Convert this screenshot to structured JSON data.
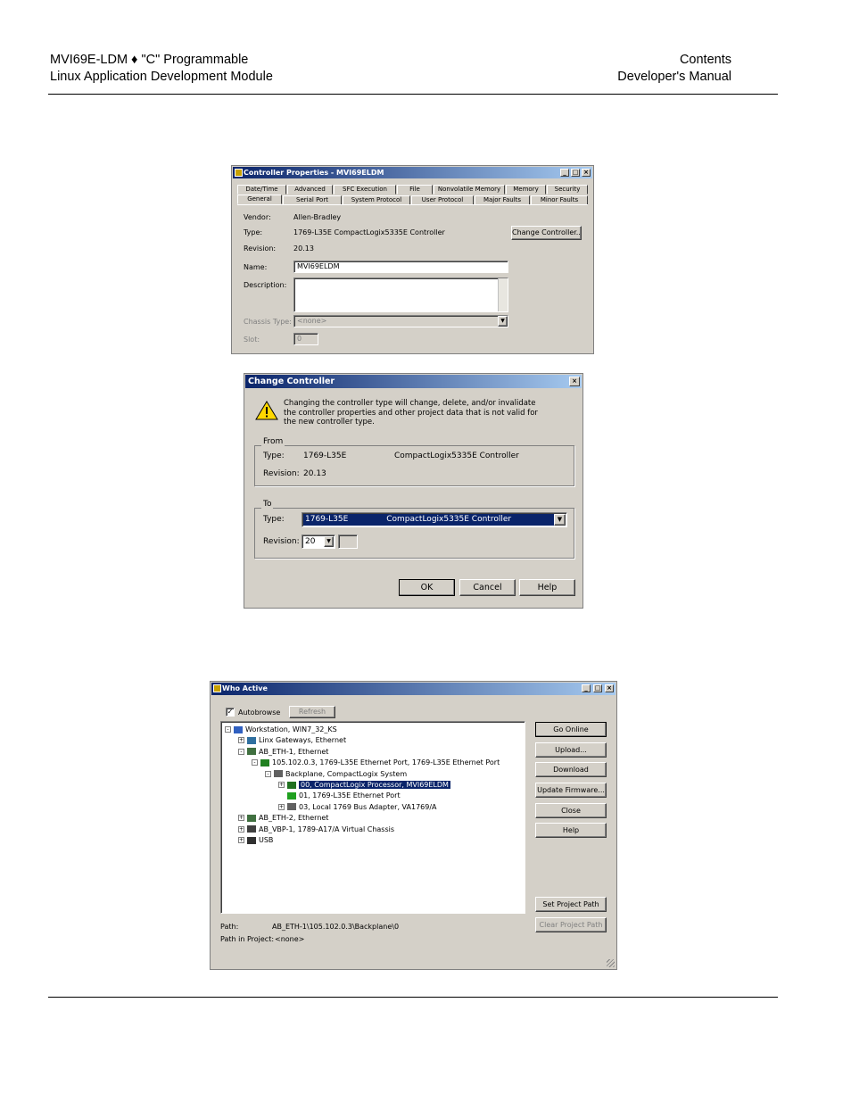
{
  "header": {
    "left_line1": "MVI69E-LDM ♦ \"C\" Programmable",
    "left_line2": "Linux Application Development Module",
    "right_line1": "Contents",
    "right_line2": "Developer's Manual"
  },
  "controller_properties": {
    "title": "Controller Properties - MVI69ELDM",
    "tabs_row1": [
      "Date/Time",
      "Advanced",
      "SFC Execution",
      "File",
      "Nonvolatile Memory",
      "Memory",
      "Security"
    ],
    "tabs_row2": [
      "General",
      "Serial Port",
      "System Protocol",
      "User Protocol",
      "Major Faults",
      "Minor Faults"
    ],
    "vendor_label": "Vendor:",
    "vendor_value": "Allen-Bradley",
    "type_label": "Type:",
    "type_value": "1769-L35E CompactLogix5335E Controller",
    "revision_label": "Revision:",
    "revision_value": "20.13",
    "change_button": "Change Controller...",
    "name_label": "Name:",
    "name_value": "MVI69ELDM",
    "description_label": "Description:",
    "chassis_label": "Chassis Type:",
    "chassis_value": "<none>",
    "slot_label": "Slot:",
    "slot_value": "0"
  },
  "change_controller": {
    "title": "Change Controller",
    "warning": "Changing the controller type will change, delete, and/or invalidate the controller properties and other project data that is not valid for the new controller type.",
    "from_title": "From",
    "from_type_label": "Type:",
    "from_type_code": "1769-L35E",
    "from_type_desc": "CompactLogix5335E Controller",
    "from_revision_label": "Revision:",
    "from_revision_value": "20.13",
    "to_title": "To",
    "to_type_label": "Type:",
    "to_type_code": "1769-L35E",
    "to_type_desc": "CompactLogix5335E Controller",
    "to_revision_label": "Revision:",
    "to_revision_value": "20",
    "ok": "OK",
    "cancel": "Cancel",
    "help": "Help"
  },
  "who_active": {
    "title": "Who Active",
    "autobrowse": "Autobrowse",
    "refresh": "Refresh",
    "tree": [
      {
        "label": "Workstation, WIN7_32_KS",
        "depth": 0,
        "exp": "-"
      },
      {
        "label": "Linx Gateways, Ethernet",
        "depth": 1,
        "exp": "+"
      },
      {
        "label": "AB_ETH-1, Ethernet",
        "depth": 1,
        "exp": "-"
      },
      {
        "label": "105.102.0.3, 1769-L35E Ethernet Port, 1769-L35E Ethernet Port",
        "depth": 2,
        "exp": "-"
      },
      {
        "label": "Backplane, CompactLogix System",
        "depth": 3,
        "exp": "-"
      },
      {
        "label": "00, CompactLogix Processor, MVI69ELDM",
        "depth": 4,
        "exp": "+",
        "selected": true
      },
      {
        "label": "01, 1769-L35E Ethernet Port",
        "depth": 4,
        "exp": ""
      },
      {
        "label": "03, Local 1769 Bus Adapter, VA1769/A",
        "depth": 4,
        "exp": "+"
      },
      {
        "label": "AB_ETH-2, Ethernet",
        "depth": 1,
        "exp": "+"
      },
      {
        "label": "AB_VBP-1, 1789-A17/A Virtual Chassis",
        "depth": 1,
        "exp": "+"
      },
      {
        "label": "USB",
        "depth": 1,
        "exp": "+"
      }
    ],
    "buttons": [
      "Go Online",
      "Upload...",
      "Download",
      "Update Firmware...",
      "Close",
      "Help"
    ],
    "set_project_path": "Set Project Path",
    "clear_project_path": "Clear Project Path",
    "path_label": "Path:",
    "path_value": "AB_ETH-1\\105.102.0.3\\Backplane\\0",
    "path_in_project_label": "Path in Project:",
    "path_in_project_value": "<none>"
  }
}
